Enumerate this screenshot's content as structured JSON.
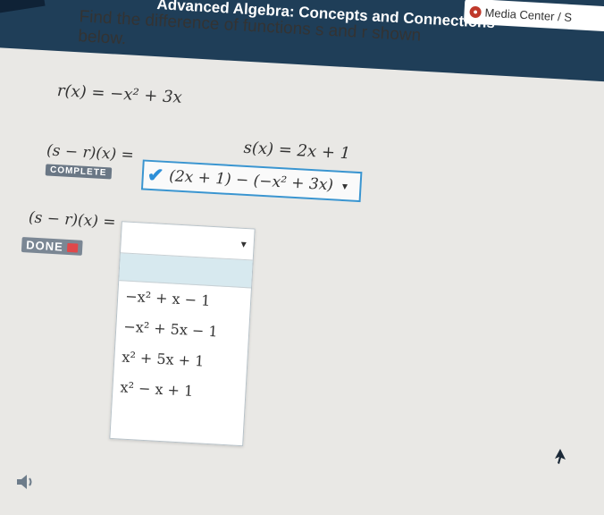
{
  "header": {
    "course_title": "Advanced Algebra: Concepts and Connections",
    "media_center_label": "Media Center / S"
  },
  "question": {
    "prompt_line1": "Find the difference of functions s and r shown",
    "prompt_line2": "below."
  },
  "functions": {
    "r": "r(x) = −x² + 3x",
    "s": "s(x) = 2x + 1"
  },
  "step1": {
    "label": "(s − r)(x) =",
    "badge": "COMPLETE",
    "answer": "(2x + 1) − (−x² + 3x)"
  },
  "step2": {
    "label": "(s − r)(x) =",
    "badge": "DONE",
    "options": [
      "−x² + x − 1",
      "−x² + 5x − 1",
      "x² + 5x + 1",
      "x² − x + 1"
    ]
  },
  "colors": {
    "header_bg": "#1f3e58",
    "answer_border": "#3a95d0",
    "check": "#2d8fd8",
    "highlight": "#d7e9ef"
  }
}
